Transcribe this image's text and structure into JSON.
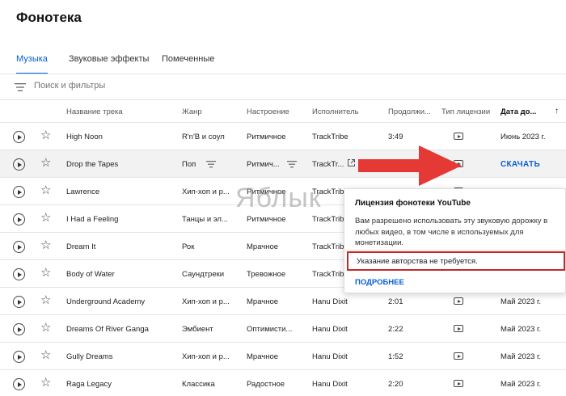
{
  "page": {
    "title": "Фонотека"
  },
  "tabs": [
    {
      "label": "Музыка",
      "active": true
    },
    {
      "label": "Звуковые эффекты",
      "active": false
    },
    {
      "label": "Помеченные",
      "active": false
    }
  ],
  "filter": {
    "placeholder": "Поиск и фильтры"
  },
  "columns": [
    "Название трека",
    "Жанр",
    "Настроение",
    "Исполнитель",
    "Продолжи...",
    "Тип лицензии",
    "Дата до..."
  ],
  "rows": [
    {
      "title": "High Noon",
      "genre": "R'n'B и соул",
      "mood": "Ритмичное",
      "artist": "TrackTribe",
      "duration": "3:49",
      "date": "Июнь 2023 г."
    },
    {
      "title": "Drop the Tapes",
      "genre": "Поп",
      "mood": "Ритмич...",
      "artist": "TrackTr...",
      "duration": "",
      "date": "",
      "action": "СКАЧАТЬ",
      "highlighted": true
    },
    {
      "title": "Lawrence",
      "genre": "Хип-хоп и р...",
      "mood": "Ритмичное",
      "artist": "TrackTribe",
      "duration": "",
      "date": ""
    },
    {
      "title": "I Had a Feeling",
      "genre": "Танцы и эл...",
      "mood": "Ритмичное",
      "artist": "TrackTribe",
      "duration": "",
      "date": ""
    },
    {
      "title": "Dream It",
      "genre": "Рок",
      "mood": "Мрачное",
      "artist": "TrackTribe",
      "duration": "",
      "date": ""
    },
    {
      "title": "Body of Water",
      "genre": "Саундтреки",
      "mood": "Тревожное",
      "artist": "TrackTribe",
      "duration": "",
      "date": ""
    },
    {
      "title": "Underground Academy",
      "genre": "Хип-хоп и р...",
      "mood": "Мрачное",
      "artist": "Hanu Dixit",
      "duration": "2:01",
      "date": "Май 2023 г."
    },
    {
      "title": "Dreams Of River Ganga",
      "genre": "Эмбиент",
      "mood": "Оптимисти...",
      "artist": "Hanu Dixit",
      "duration": "2:22",
      "date": "Май 2023 г."
    },
    {
      "title": "Gully Dreams",
      "genre": "Хип-хоп и р...",
      "mood": "Мрачное",
      "artist": "Hanu Dixit",
      "duration": "1:52",
      "date": "Май 2023 г."
    },
    {
      "title": "Raga Legacy",
      "genre": "Классика",
      "mood": "Радостное",
      "artist": "Hanu Dixit",
      "duration": "2:20",
      "date": "Май 2023 г."
    }
  ],
  "popup": {
    "title": "Лицензия фонотеки YouTube",
    "body": "Вам разрешено использовать эту звуковую дорожку в любых видео, в том числе в используемых для монетизации.",
    "note": "Указание авторства не требуется.",
    "link": "ПОДРОБНЕЕ"
  },
  "watermark": "Яблык",
  "icons": {
    "play": "play-icon",
    "star": "star-icon",
    "license": "youtube-license-icon",
    "filter": "filter-icon",
    "external": "external-link-icon"
  },
  "colors": {
    "accent": "#065fd4",
    "highlight_box": "#c62828",
    "arrow": "#e53935"
  }
}
